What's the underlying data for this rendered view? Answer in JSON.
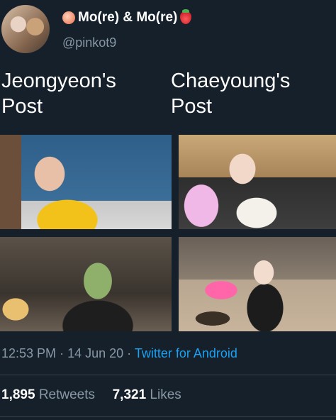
{
  "tweet": {
    "author": {
      "display_name": "Mo(re) & Mo(re)",
      "name_emoji_left": "peach-icon",
      "name_emoji_right": "strawberry-icon",
      "handle": "@pinkot9"
    },
    "caption": {
      "left_line1": "Jeongyeon's",
      "left_line2": "Post",
      "right_line1": "Chaeyoung's",
      "right_line2": "Post"
    },
    "meta": {
      "time": "12:53 PM",
      "separator": "·",
      "date": "14 Jun 20",
      "source": "Twitter for Android"
    },
    "stats": {
      "retweets_count": "1,895",
      "retweets_label": "Retweets",
      "likes_count": "7,321",
      "likes_label": "Likes"
    }
  },
  "colors": {
    "background": "#15202b",
    "secondary_text": "#8899a6",
    "link": "#1da1f2",
    "divider": "#38444d"
  }
}
